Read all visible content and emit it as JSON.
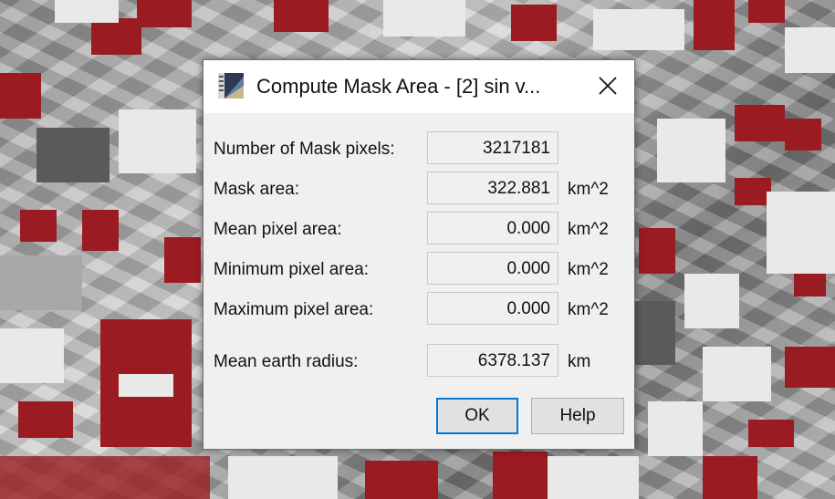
{
  "dialog": {
    "title": "Compute Mask Area - [2] sin v...",
    "icons": {
      "app": "snap-app-icon",
      "close": "close-icon"
    },
    "rows": [
      {
        "label": "Number of Mask pixels:",
        "value": "3217181",
        "unit": ""
      },
      {
        "label": "Mask area:",
        "value": "322.881",
        "unit": "km^2"
      },
      {
        "label": "Mean pixel area:",
        "value": "0.000",
        "unit": "km^2"
      },
      {
        "label": "Minimum pixel area:",
        "value": "0.000",
        "unit": "km^2"
      },
      {
        "label": "Maximum pixel area:",
        "value": "0.000",
        "unit": "km^2"
      },
      {
        "label": "Mean earth radius:",
        "value": "6378.137",
        "unit": "km"
      }
    ],
    "buttons": {
      "ok": "OK",
      "help": "Help"
    }
  },
  "colors": {
    "mask": "#9b1b22",
    "focus": "#0078d7",
    "dialog_bg": "#f0f0f0"
  }
}
